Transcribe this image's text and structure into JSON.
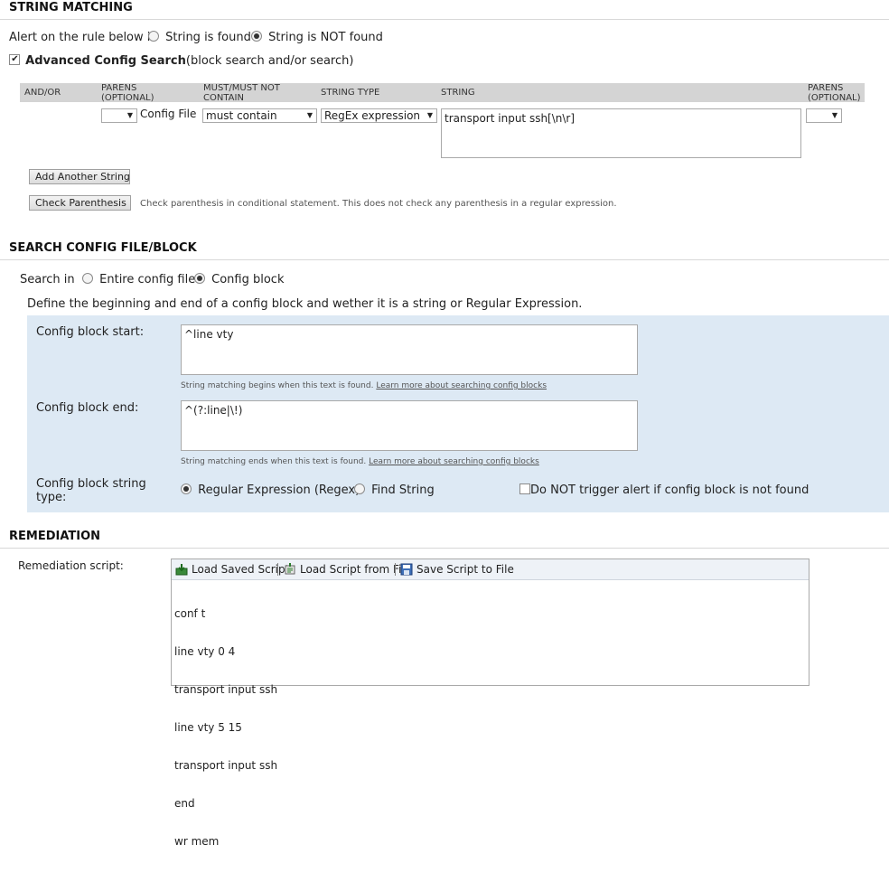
{
  "string_matching": {
    "heading": "STRING MATCHING",
    "alert_prefix": "Alert on the rule below if",
    "option_found": "String is found",
    "option_not_found": "String is NOT found",
    "selected": "String is NOT found",
    "advanced_label": "Advanced Config Search",
    "advanced_suffix": "(block search and/or search)",
    "advanced_checked": true,
    "table": {
      "col_andor": "AND/OR",
      "col_parens_1": "PARENS",
      "col_parens_1b": "(OPTIONAL)",
      "col_must_1": "MUST/MUST NOT",
      "col_must_2": "CONTAIN",
      "col_type": "STRING TYPE",
      "col_string": "STRING",
      "col_parens_2": "PARENS",
      "col_parens_2b": "(OPTIONAL)",
      "row": {
        "open_paren": "",
        "source": "Config File",
        "must": "must contain",
        "type": "RegEx expression",
        "string": "transport input ssh[\\n\\r]",
        "close_paren": ""
      }
    },
    "add_button": "Add Another String",
    "check_button": "Check Parenthesis",
    "check_hint": "Check parenthesis in conditional statement. This does not check any parenthesis in a regular expression."
  },
  "search_config": {
    "heading": "SEARCH CONFIG FILE/BLOCK",
    "search_in": "Search in",
    "option_entire": "Entire config file",
    "option_block": "Config block",
    "selected": "Config block",
    "description": "Define the beginning and end of a config block and wether it is a string or Regular Expression.",
    "start_label": "Config block start:",
    "start_value": "^line vty",
    "start_hint": "String matching begins when this text is found.",
    "start_link": "Learn more about searching config blocks",
    "end_label": "Config block end:",
    "end_value": "^(?:line|\\!)",
    "end_hint": "String matching ends when this text is found.",
    "end_link": "Learn more about searching config blocks",
    "type_label_1": "Config block string",
    "type_label_2": "type:",
    "option_regex": "Regular Expression (Regex)",
    "option_string": "Find String",
    "type_selected": "Regular Expression (Regex)",
    "no_trigger_label": "Do NOT trigger alert if config block is not found",
    "no_trigger_checked": false
  },
  "remediation": {
    "heading": "REMEDIATION",
    "script_label": "Remediation script:",
    "load_saved": "Load Saved Script",
    "load_file": "Load Script from File",
    "save_file": "Save Script to File",
    "script_lines": [
      "conf t",
      "line vty 0 4",
      "transport input ssh",
      "line vty 5 15",
      "transport input ssh",
      "end",
      "wr mem"
    ]
  },
  "colors": {
    "table_header_bg": "#d4d4d4",
    "block_panel_bg": "#dde9f4",
    "toolbar_bg": "#eef2f7"
  }
}
